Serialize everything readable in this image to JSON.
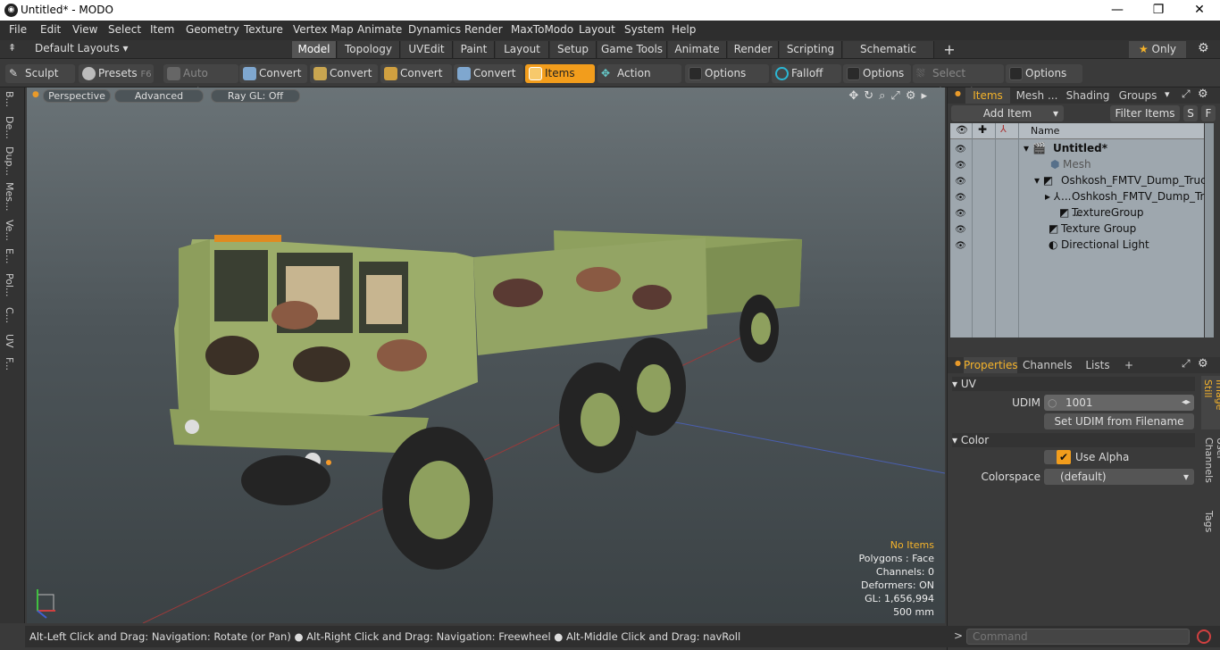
{
  "window": {
    "title": "Untitled* - MODO",
    "app_icon": "modo-icon",
    "min": "—",
    "max": "❐",
    "close": "✕"
  },
  "menu": [
    "File",
    "Edit",
    "View",
    "Select",
    "Item",
    "Geometry",
    "Texture",
    "Vertex Map",
    "Animate",
    "Dynamics",
    "Render",
    "MaxToModo",
    "Layout",
    "System",
    "Help"
  ],
  "layoutbar": {
    "layouts_label": "Default Layouts",
    "tabs": [
      "Model",
      "Topology",
      "UVEdit",
      "Paint",
      "Layout",
      "Setup",
      "Game Tools",
      "Animate",
      "Render",
      "Scripting",
      "Schematic Fusion"
    ],
    "active_tab": "Model",
    "plus": "+",
    "only_label": "Only"
  },
  "toolbar": {
    "items": [
      {
        "label": "Sculpt",
        "icon": "sculpt-brush-icon"
      },
      {
        "label": "Presets",
        "shortcut": "F6",
        "icon": "presets-icon"
      },
      {
        "label": "Auto Select",
        "icon": "auto-select-cube-icon"
      },
      {
        "label": "Convert",
        "icon": "convert-cube-icon"
      },
      {
        "label": "Convert",
        "icon": "convert-cube-icon"
      },
      {
        "label": "Convert",
        "icon": "convert-cube-icon"
      },
      {
        "label": "Convert",
        "icon": "convert-cube-icon"
      },
      {
        "label": "Items",
        "icon": "items-cube-icon"
      },
      {
        "label": "Action Center",
        "icon": "action-center-icon"
      },
      {
        "label": "Options",
        "icon": "options-icon"
      },
      {
        "label": "Falloff",
        "icon": "falloff-icon"
      },
      {
        "label": "Options",
        "icon": "options-icon"
      },
      {
        "label": "Select Through",
        "icon": "select-through-icon"
      },
      {
        "label": "Options",
        "icon": "options-icon"
      }
    ]
  },
  "left_tabs": [
    "B...",
    "De...",
    "Dup...",
    "Mes...",
    "Ve...",
    "E...",
    "Pol...",
    "C...",
    "UV",
    "F..."
  ],
  "viewport": {
    "buttons": [
      "Perspective",
      "Advanced",
      "Ray GL: Off"
    ],
    "info": {
      "selection": "No Items",
      "polygons": "Polygons : Face",
      "channels": "Channels: 0",
      "deformers": "Deformers: ON",
      "gl": "GL: 1,656,994",
      "scale": "500 mm"
    }
  },
  "status": "Alt-Left Click and Drag: Navigation: Rotate (or Pan) ● Alt-Right Click and Drag: Navigation: Freewheel ● Alt-Middle Click and Drag: navRoll",
  "items_panel": {
    "tabs": [
      "Items",
      "Mesh ...",
      "Shading",
      "Groups"
    ],
    "add_item": "Add Item",
    "filter_items": "Filter Items",
    "s_btn": "S",
    "f_btn": "F",
    "col_name": "Name",
    "rows": [
      {
        "label": "Untitled*",
        "indent": 0,
        "bold": true
      },
      {
        "label": "Mesh",
        "indent": 1,
        "dim": true
      },
      {
        "label": "Oshkosh_FMTV_Dump_Truck ...",
        "indent": 1
      },
      {
        "label": "Oshkosh_FMTV_Dump_Tru ...",
        "indent": 2
      },
      {
        "label": "TextureGroup",
        "indent": 2
      },
      {
        "label": "Texture Group",
        "indent": 1
      },
      {
        "label": "Directional Light",
        "indent": 1
      }
    ]
  },
  "properties": {
    "tabs": [
      "Properties",
      "Channels",
      "Lists",
      "+"
    ],
    "uv_section": "UV",
    "udim_label": "UDIM",
    "udim_value": "1001",
    "set_udim": "Set UDIM from Filename",
    "color_section": "Color",
    "use_alpha": "Use Alpha",
    "colorspace_label": "Colorspace",
    "colorspace_value": "(default)",
    "side_tabs": [
      "Image Still",
      "User Channels",
      "Tags"
    ]
  },
  "command": {
    "placeholder": "Command"
  }
}
